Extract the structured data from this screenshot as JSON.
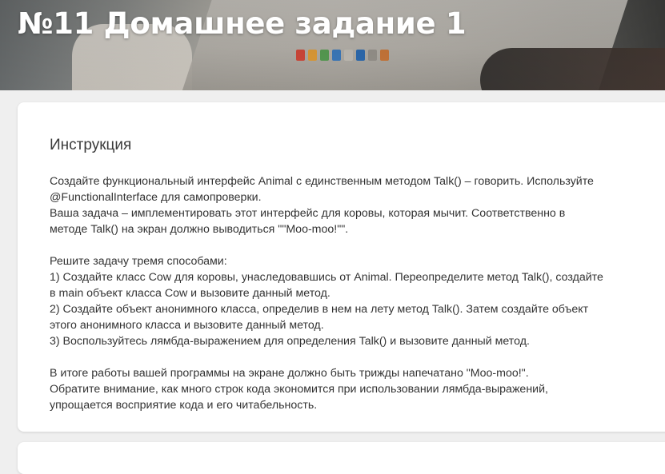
{
  "header": {
    "title": "№11 Домашнее задание 1"
  },
  "card": {
    "heading": "Инструкция",
    "lines": [
      "Создайте функциональный интерфейс Animal с единственным методом Talk() – говорить. Используйте",
      "@FunctionalInterface для самопроверки.",
      "Ваша задача – имплементировать этот интерфейс для коровы, которая мычит. Соответственно в",
      "методе Talk() на экран должно выводиться \"\"Moo-moo!\"\".",
      "Решите задачу тремя способами:",
      "1) Создайте класс Cow для коровы, унаследовавшись от Animal. Переопределите метод Talk(), создайте",
      "в main объект класса Cow и вызовите данный метод.",
      "2) Создайте объект анонимного класса, определив в нем на лету метод Talk(). Затем создайте объект",
      "этого анонимного класса и вызовите данный метод.",
      "3) Воспользуйтесь лямбда-выражением для определения Talk() и вызовите данный метод.",
      "В итоге работы вашей программы на экране должно быть трижды напечатано \"Moo-moo!\".",
      "Обратите внимание, как много строк кода экономится при использовании лямбда-выражений,",
      "упрощается восприятие кода и его читабельность."
    ]
  },
  "colors": {
    "page_bg": "#efefef",
    "card_bg": "#ffffff",
    "title_text": "#ffffff",
    "body_text": "#333333"
  }
}
